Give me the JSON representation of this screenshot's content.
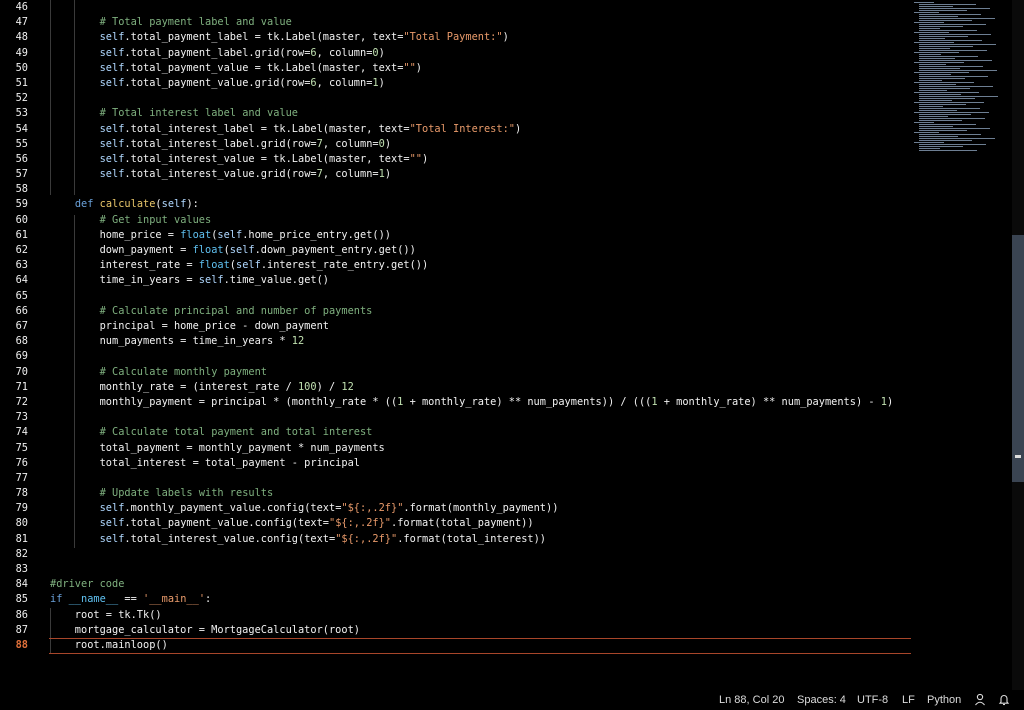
{
  "editor": {
    "active_line": 88,
    "lines": [
      {
        "n": "46",
        "t": [
          {
            "k": "p",
            "v": "        "
          }
        ]
      },
      {
        "n": "47",
        "t": [
          {
            "k": "p",
            "v": "        "
          },
          {
            "k": "cm",
            "v": "# Total payment label and value"
          }
        ]
      },
      {
        "n": "48",
        "t": [
          {
            "k": "p",
            "v": "        "
          },
          {
            "k": "self",
            "v": "self"
          },
          {
            "k": "p",
            "v": ".total_payment_label = tk.Label(master, text="
          },
          {
            "k": "str",
            "v": "\"Total Payment:\""
          },
          {
            "k": "p",
            "v": ")"
          }
        ]
      },
      {
        "n": "49",
        "t": [
          {
            "k": "p",
            "v": "        "
          },
          {
            "k": "self",
            "v": "self"
          },
          {
            "k": "p",
            "v": ".total_payment_label.grid(row="
          },
          {
            "k": "num",
            "v": "6"
          },
          {
            "k": "p",
            "v": ", column="
          },
          {
            "k": "num",
            "v": "0"
          },
          {
            "k": "p",
            "v": ")"
          }
        ]
      },
      {
        "n": "50",
        "t": [
          {
            "k": "p",
            "v": "        "
          },
          {
            "k": "self",
            "v": "self"
          },
          {
            "k": "p",
            "v": ".total_payment_value = tk.Label(master, text="
          },
          {
            "k": "str",
            "v": "\"\""
          },
          {
            "k": "p",
            "v": ")"
          }
        ]
      },
      {
        "n": "51",
        "t": [
          {
            "k": "p",
            "v": "        "
          },
          {
            "k": "self",
            "v": "self"
          },
          {
            "k": "p",
            "v": ".total_payment_value.grid(row="
          },
          {
            "k": "num",
            "v": "6"
          },
          {
            "k": "p",
            "v": ", column="
          },
          {
            "k": "num",
            "v": "1"
          },
          {
            "k": "p",
            "v": ")"
          }
        ]
      },
      {
        "n": "52",
        "t": [
          {
            "k": "p",
            "v": ""
          }
        ]
      },
      {
        "n": "53",
        "t": [
          {
            "k": "p",
            "v": "        "
          },
          {
            "k": "cm",
            "v": "# Total interest label and value"
          }
        ]
      },
      {
        "n": "54",
        "t": [
          {
            "k": "p",
            "v": "        "
          },
          {
            "k": "self",
            "v": "self"
          },
          {
            "k": "p",
            "v": ".total_interest_label = tk.Label(master, text="
          },
          {
            "k": "str",
            "v": "\"Total Interest:\""
          },
          {
            "k": "p",
            "v": ")"
          }
        ]
      },
      {
        "n": "55",
        "t": [
          {
            "k": "p",
            "v": "        "
          },
          {
            "k": "self",
            "v": "self"
          },
          {
            "k": "p",
            "v": ".total_interest_label.grid(row="
          },
          {
            "k": "num",
            "v": "7"
          },
          {
            "k": "p",
            "v": ", column="
          },
          {
            "k": "num",
            "v": "0"
          },
          {
            "k": "p",
            "v": ")"
          }
        ]
      },
      {
        "n": "56",
        "t": [
          {
            "k": "p",
            "v": "        "
          },
          {
            "k": "self",
            "v": "self"
          },
          {
            "k": "p",
            "v": ".total_interest_value = tk.Label(master, text="
          },
          {
            "k": "str",
            "v": "\"\""
          },
          {
            "k": "p",
            "v": ")"
          }
        ]
      },
      {
        "n": "57",
        "t": [
          {
            "k": "p",
            "v": "        "
          },
          {
            "k": "self",
            "v": "self"
          },
          {
            "k": "p",
            "v": ".total_interest_value.grid(row="
          },
          {
            "k": "num",
            "v": "7"
          },
          {
            "k": "p",
            "v": ", column="
          },
          {
            "k": "num",
            "v": "1"
          },
          {
            "k": "p",
            "v": ")"
          }
        ]
      },
      {
        "n": "58",
        "t": [
          {
            "k": "p",
            "v": ""
          }
        ]
      },
      {
        "n": "59",
        "t": [
          {
            "k": "p",
            "v": "    "
          },
          {
            "k": "kw",
            "v": "def"
          },
          {
            "k": "p",
            "v": " "
          },
          {
            "k": "fn",
            "v": "calculate"
          },
          {
            "k": "p",
            "v": "("
          },
          {
            "k": "self",
            "v": "self"
          },
          {
            "k": "p",
            "v": "):"
          }
        ]
      },
      {
        "n": "60",
        "t": [
          {
            "k": "p",
            "v": "        "
          },
          {
            "k": "cm",
            "v": "# Get input values"
          }
        ]
      },
      {
        "n": "61",
        "t": [
          {
            "k": "p",
            "v": "        home_price = "
          },
          {
            "k": "bp",
            "v": "float"
          },
          {
            "k": "p",
            "v": "("
          },
          {
            "k": "self",
            "v": "self"
          },
          {
            "k": "p",
            "v": ".home_price_entry.get())"
          }
        ]
      },
      {
        "n": "62",
        "t": [
          {
            "k": "p",
            "v": "        down_payment = "
          },
          {
            "k": "bp",
            "v": "float"
          },
          {
            "k": "p",
            "v": "("
          },
          {
            "k": "self",
            "v": "self"
          },
          {
            "k": "p",
            "v": ".down_payment_entry.get())"
          }
        ]
      },
      {
        "n": "63",
        "t": [
          {
            "k": "p",
            "v": "        interest_rate = "
          },
          {
            "k": "bp",
            "v": "float"
          },
          {
            "k": "p",
            "v": "("
          },
          {
            "k": "self",
            "v": "self"
          },
          {
            "k": "p",
            "v": ".interest_rate_entry.get())"
          }
        ]
      },
      {
        "n": "64",
        "t": [
          {
            "k": "p",
            "v": "        time_in_years = "
          },
          {
            "k": "self",
            "v": "self"
          },
          {
            "k": "p",
            "v": ".time_value.get()"
          }
        ]
      },
      {
        "n": "65",
        "t": [
          {
            "k": "p",
            "v": ""
          }
        ]
      },
      {
        "n": "66",
        "t": [
          {
            "k": "p",
            "v": "        "
          },
          {
            "k": "cm",
            "v": "# Calculate principal and number of payments"
          }
        ]
      },
      {
        "n": "67",
        "t": [
          {
            "k": "p",
            "v": "        principal = home_price - down_payment"
          }
        ]
      },
      {
        "n": "68",
        "t": [
          {
            "k": "p",
            "v": "        num_payments = time_in_years * "
          },
          {
            "k": "num",
            "v": "12"
          }
        ]
      },
      {
        "n": "69",
        "t": [
          {
            "k": "p",
            "v": ""
          }
        ]
      },
      {
        "n": "70",
        "t": [
          {
            "k": "p",
            "v": "        "
          },
          {
            "k": "cm",
            "v": "# Calculate monthly payment"
          }
        ]
      },
      {
        "n": "71",
        "t": [
          {
            "k": "p",
            "v": "        monthly_rate = (interest_rate / "
          },
          {
            "k": "num",
            "v": "100"
          },
          {
            "k": "p",
            "v": ") / "
          },
          {
            "k": "num",
            "v": "12"
          }
        ]
      },
      {
        "n": "72",
        "t": [
          {
            "k": "p",
            "v": "        monthly_payment = principal * (monthly_rate * (("
          },
          {
            "k": "num",
            "v": "1"
          },
          {
            "k": "p",
            "v": " + monthly_rate) ** num_payments)) / ((("
          },
          {
            "k": "num",
            "v": "1"
          },
          {
            "k": "p",
            "v": " + monthly_rate) ** num_payments) - "
          },
          {
            "k": "num",
            "v": "1"
          },
          {
            "k": "p",
            "v": ")"
          }
        ]
      },
      {
        "n": "73",
        "t": [
          {
            "k": "p",
            "v": ""
          }
        ]
      },
      {
        "n": "74",
        "t": [
          {
            "k": "p",
            "v": "        "
          },
          {
            "k": "cm",
            "v": "# Calculate total payment and total interest"
          }
        ]
      },
      {
        "n": "75",
        "t": [
          {
            "k": "p",
            "v": "        total_payment = monthly_payment * num_payments"
          }
        ]
      },
      {
        "n": "76",
        "t": [
          {
            "k": "p",
            "v": "        total_interest = total_payment - principal"
          }
        ]
      },
      {
        "n": "77",
        "t": [
          {
            "k": "p",
            "v": ""
          }
        ]
      },
      {
        "n": "78",
        "t": [
          {
            "k": "p",
            "v": "        "
          },
          {
            "k": "cm",
            "v": "# Update labels with results"
          }
        ]
      },
      {
        "n": "79",
        "t": [
          {
            "k": "p",
            "v": "        "
          },
          {
            "k": "self",
            "v": "self"
          },
          {
            "k": "p",
            "v": ".monthly_payment_value.config(text="
          },
          {
            "k": "str",
            "v": "\"${:,.2f}\""
          },
          {
            "k": "p",
            "v": ".format(monthly_payment))"
          }
        ]
      },
      {
        "n": "80",
        "t": [
          {
            "k": "p",
            "v": "        "
          },
          {
            "k": "self",
            "v": "self"
          },
          {
            "k": "p",
            "v": ".total_payment_value.config(text="
          },
          {
            "k": "str",
            "v": "\"${:,.2f}\""
          },
          {
            "k": "p",
            "v": ".format(total_payment))"
          }
        ]
      },
      {
        "n": "81",
        "t": [
          {
            "k": "p",
            "v": "        "
          },
          {
            "k": "self",
            "v": "self"
          },
          {
            "k": "p",
            "v": ".total_interest_value.config(text="
          },
          {
            "k": "str",
            "v": "\"${:,.2f}\""
          },
          {
            "k": "p",
            "v": ".format(total_interest))"
          }
        ]
      },
      {
        "n": "82",
        "t": [
          {
            "k": "p",
            "v": ""
          }
        ]
      },
      {
        "n": "83",
        "t": [
          {
            "k": "p",
            "v": ""
          }
        ]
      },
      {
        "n": "84",
        "t": [
          {
            "k": "cm",
            "v": "#driver code"
          }
        ]
      },
      {
        "n": "85",
        "t": [
          {
            "k": "kw",
            "v": "if"
          },
          {
            "k": "p",
            "v": " "
          },
          {
            "k": "bp",
            "v": "__name__"
          },
          {
            "k": "p",
            "v": " == "
          },
          {
            "k": "str",
            "v": "'__main__'"
          },
          {
            "k": "p",
            "v": ":"
          }
        ]
      },
      {
        "n": "86",
        "t": [
          {
            "k": "p",
            "v": "    root = tk.Tk()"
          }
        ]
      },
      {
        "n": "87",
        "t": [
          {
            "k": "p",
            "v": "    mortgage_calculator = MortgageCalculator(root)"
          }
        ]
      },
      {
        "n": "88",
        "t": [
          {
            "k": "p",
            "v": "    root.mainloop()"
          }
        ]
      }
    ]
  },
  "status": {
    "position": "Ln 88, Col 20",
    "spaces": "Spaces: 4",
    "encoding": "UTF-8",
    "eol": "LF",
    "language": "Python",
    "feedback_icon": "feedback-person-icon",
    "bell_icon": "bell-icon"
  }
}
